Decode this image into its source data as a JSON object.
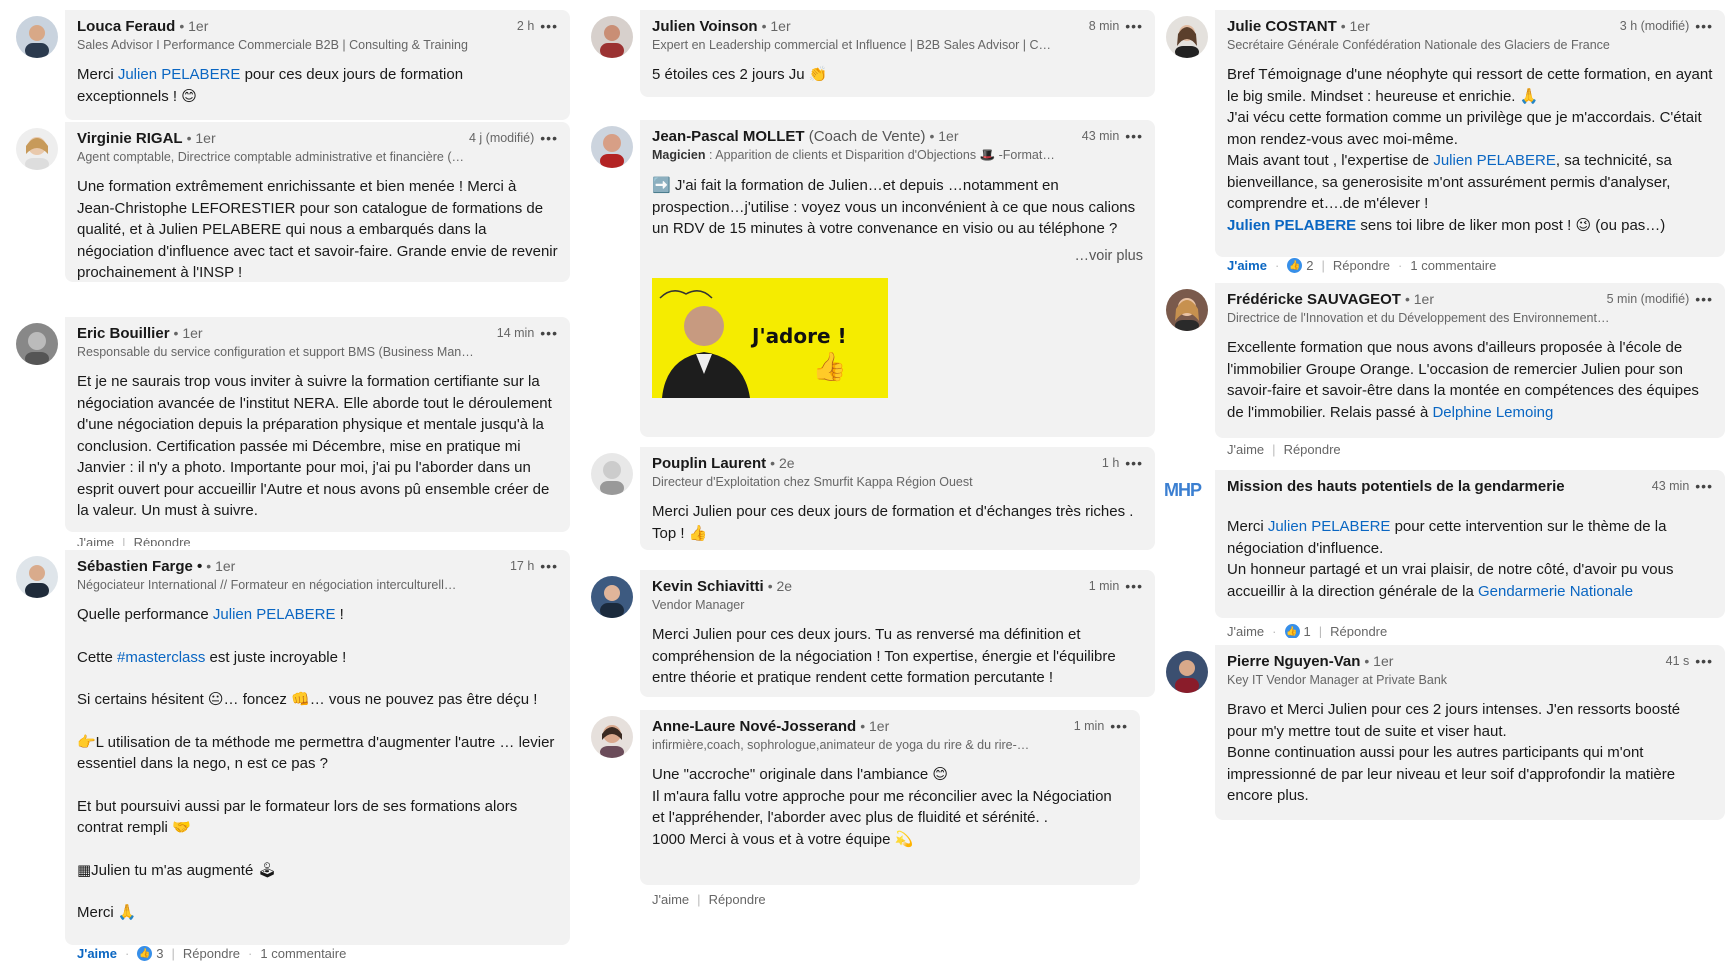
{
  "comments": [
    {
      "name": "Louca Feraud",
      "degree": "• 1er",
      "time": "2 h",
      "headline": "Sales Advisor I Performance Commerciale B2B | Consulting & Training",
      "b0": "Merci ",
      "m0": "Julien PELABERE",
      "b1": " pour ces deux jours de formation exceptionnels ! 😊"
    },
    {
      "name": "Virginie RIGAL",
      "degree": "• 1er",
      "time": "4 j (modifié)",
      "headline": "Agent comptable, Directrice comptable administrative et financière (…",
      "b0": "Une formation extrêmement enrichissante et bien menée ! Merci à Jean-Christophe LEFORESTIER pour son catalogue de formations de qualité, et à Julien PELABERE qui nous a embarqués dans la négociation d'influence avec tact et savoir-faire. Grande envie de revenir prochainement à l'INSP !"
    },
    {
      "name": "Eric Bouillier",
      "degree": "• 1er",
      "time": "14 min",
      "headline": "Responsable du service configuration et support BMS (Business Man…",
      "b0": "Et je ne saurais trop vous inviter à suivre la formation certifiante sur la négociation avancée de l'institut NERA. Elle aborde tout le déroulement d'une négociation depuis la préparation physique et mentale jusqu'à la conclusion. Certification passée mi Décembre, mise en pratique mi Janvier : il n'y a photo. Importante pour moi, j'ai pu l'aborder dans un esprit ouvert pour accueillir l'Autre et nous avons pû ensemble créer de la valeur. Un must à suivre."
    },
    {
      "name": "Sébastien Farge •",
      "degree": "• 1er",
      "time": "17 h",
      "headline": "Négociateur International // Formateur en négociation interculturell…",
      "l1a": "Quelle performance ",
      "l1m": "Julien PELABERE",
      "l1b": " !",
      "l2a": "Cette ",
      "l2h": "#masterclass",
      "l2b": " est juste incroyable !",
      "l3": "Si certains hésitent 😐… foncez 👊… vous ne pouvez pas être déçu !",
      "l4": "👉L utilisation de ta méthode me permettra d'augmenter l'autre … levier essentiel dans la nego, n est ce pas ?",
      "l5": "Et but poursuivi aussi par le formateur lors de ses formations alors contrat rempli 🤝",
      "l6": "▦Julien tu m'as augmenté 🕹",
      "l7": "Merci 🙏",
      "like": "J'aime",
      "react": "3",
      "reply": "Répondre",
      "comments": "1 commentaire"
    },
    {
      "name": "Julien Voinson",
      "degree": "• 1er",
      "time": "8 min",
      "headline": "Expert en Leadership commercial et Influence | B2B Sales Advisor | C…",
      "b0": "5 étoiles ces 2 jours Ju 👏"
    },
    {
      "name": "Jean-Pascal MOLLET",
      "role": "(Coach de Vente)",
      "degree": "• 1er",
      "time": "43 min",
      "headline_bold": "Magicien",
      "headline": " : Apparition de clients et Disparition d'Objections 🎩 -Format…",
      "b0": "➡️ J'ai fait la formation de Julien…et depuis …notamment en prospection…j'utilise : voyez vous un inconvénient à ce que nous calions un RDV de 15 minutes à votre convenance en visio ou au téléphone ?",
      "more": "…voir plus",
      "image_text": "J'adore !"
    },
    {
      "name": "Pouplin Laurent",
      "degree": "• 2e",
      "time": "1 h",
      "headline": "Directeur d'Exploitation chez Smurfit Kappa Région Ouest",
      "b0": "Merci Julien pour ces deux jours de formation et d'échanges très riches . Top ! 👍"
    },
    {
      "name": "Kevin Schiavitti",
      "degree": "• 2e",
      "time": "1 min",
      "headline": "Vendor Manager",
      "b0": "Merci Julien pour ces deux jours. Tu as renversé ma définition et compréhension de la négociation ! Ton expertise, énergie et l'équilibre entre théorie et pratique rendent cette formation percutante !"
    },
    {
      "name": "Anne-Laure Nové-Josserand",
      "degree": "• 1er",
      "time": "1 min",
      "headline": "infirmière,coach, sophrologue,animateur de yoga du rire & du rire-…",
      "l1": "Une \"accroche\" originale dans l'ambiance 😊",
      "l2": "Il m'aura fallu votre approche pour me réconcilier avec la Négociation et l'appréhender, l'aborder avec plus de fluidité et sérénité. .",
      "l3": "1000 Merci à vous et à votre équipe 💫",
      "like": "J'aime",
      "reply": "Répondre"
    },
    {
      "name": "Julie COSTANT",
      "degree": "• 1er",
      "time": "3 h (modifié)",
      "headline": "Secrétaire Générale Confédération Nationale des Glaciers de France",
      "l1": "Bref Témoignage d'une néophyte qui ressort de cette formation, en ayant le big smile. Mindset : heureuse et enrichie. 🙏",
      "l2": "J'ai vécu cette formation comme un privilège que je m'accordais. C'était mon rendez-vous avec moi-même.",
      "l3a": "Mais avant tout , l'expertise de ",
      "l3m": "Julien PELABERE",
      "l3b": ", sa technicité, sa bienveillance, sa generosisite m'ont assurément permis d'analyser, comprendre et….de m'élever !",
      "l4m": "Julien PELABERE",
      "l4b": " sens toi libre de liker mon post ! 😉 (ou pas…)",
      "like": "J'aime",
      "react": "2",
      "reply": "Répondre",
      "comments": "1 commentaire"
    },
    {
      "name": "Frédéricke SAUVAGEOT",
      "degree": "• 1er",
      "time": "5 min (modifié)",
      "headline": "Directrice de l'Innovation et du Développement des Environnement…",
      "b0": "Excellente formation que nous avons d'ailleurs proposée à l'école de l'immobilier Groupe Orange. L'occasion de remercier Julien pour son savoir-faire et savoir-être dans la montée en compétences des équipes de l'immobilier. Relais passé à ",
      "m0": "Delphine Lemoing",
      "like": "J'aime",
      "reply": "Répondre"
    },
    {
      "name": "Mission des hauts potentiels de la gendarmerie",
      "time": "43 min",
      "logo": "MHP",
      "l1a": "Merci ",
      "l1m": "Julien PELABERE",
      "l1b": " pour cette intervention sur le thème de la négociation d'influence.",
      "l2a": "Un honneur partagé et un vrai plaisir, de notre côté, d'avoir pu vous accueillir à la direction générale de la ",
      "l2m": "Gendarmerie Nationale",
      "like": "J'aime",
      "react": "1",
      "reply": "Répondre"
    },
    {
      "name": "Pierre Nguyen-Van",
      "degree": "• 1er",
      "time": "41 s",
      "headline": "Key IT Vendor Manager at Private Bank",
      "l1": "Bravo et Merci Julien pour ces 2 jours intenses. J'en ressorts boosté pour m'y mettre tout de suite et viser haut.",
      "l2": "Bonne continuation aussi pour les autres participants qui m'ont impressionné de par leur niveau et leur soif d'approfondir la matière encore plus."
    }
  ],
  "partial_actions": {
    "like": "J'aime",
    "reply": "Répondre"
  },
  "colors": {
    "accent": "#0a66c2",
    "bubble": "#f2f2f2",
    "reaction": "#378fe9",
    "image_bg": "#f5ec00"
  }
}
